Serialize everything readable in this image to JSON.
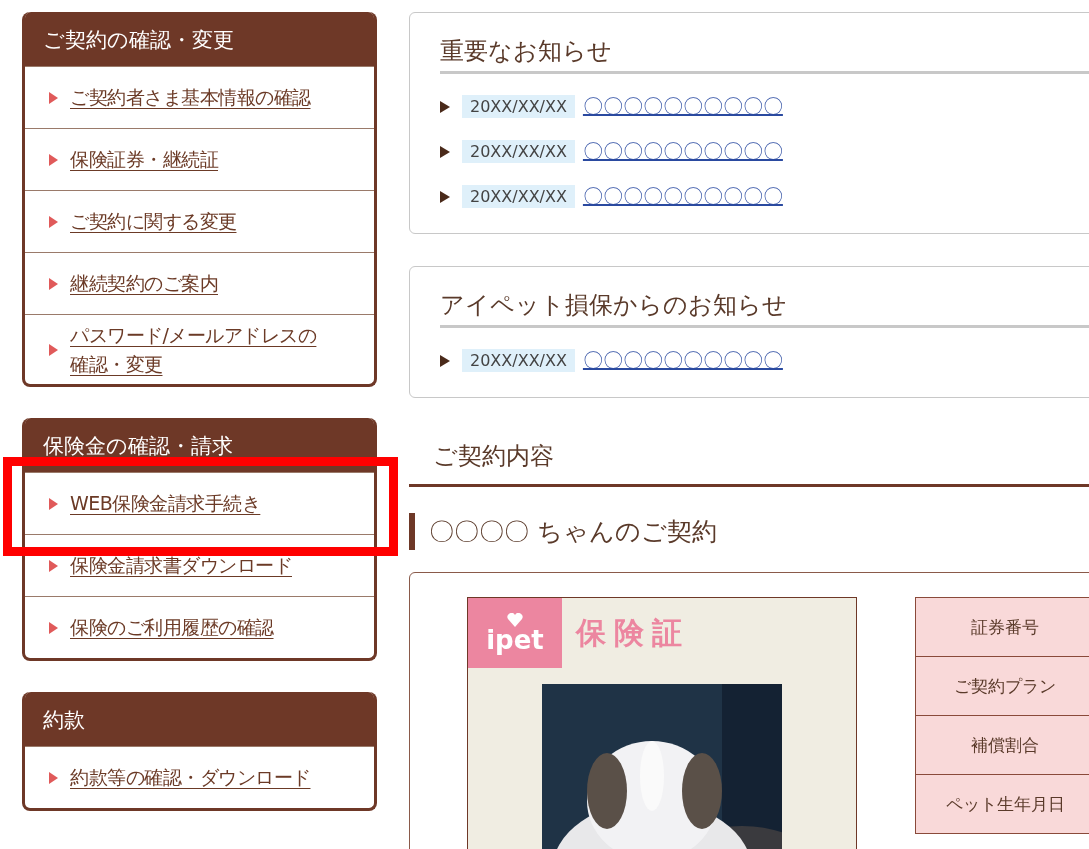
{
  "sidebar": [
    {
      "heading": "ご契約の確認・変更",
      "items": [
        {
          "label": "ご契約者さま基本情報の確認",
          "highlighted": false
        },
        {
          "label": "保険証券・継続証",
          "highlighted": false
        },
        {
          "label": "ご契約に関する変更",
          "highlighted": false
        },
        {
          "label": "継続契約のご案内",
          "highlighted": false
        },
        {
          "label": "パスワード/メールアドレスの確認・変更",
          "highlighted": false
        }
      ]
    },
    {
      "heading": "保険金の確認・請求",
      "items": [
        {
          "label": "WEB保険金請求手続き",
          "highlighted": true
        },
        {
          "label": "保険金請求書ダウンロード",
          "highlighted": false
        },
        {
          "label": "保険のご利用履歴の確認",
          "highlighted": false
        }
      ]
    },
    {
      "heading": "約款",
      "items": [
        {
          "label": "約款等の確認・ダウンロード",
          "highlighted": false
        }
      ]
    }
  ],
  "notices": [
    {
      "title": "重要なお知らせ",
      "items": [
        {
          "date": "20XX/XX/XX",
          "link": "〇〇〇〇〇〇〇〇〇〇"
        },
        {
          "date": "20XX/XX/XX",
          "link": "〇〇〇〇〇〇〇〇〇〇"
        },
        {
          "date": "20XX/XX/XX",
          "link": "〇〇〇〇〇〇〇〇〇〇"
        }
      ]
    },
    {
      "title": "アイペット損保からのお知らせ",
      "items": [
        {
          "date": "20XX/XX/XX",
          "link": "〇〇〇〇〇〇〇〇〇〇"
        }
      ]
    }
  ],
  "contract_heading": "ご契約内容",
  "contract_title": "〇〇〇〇 ちゃんのご契約",
  "certificate": {
    "logo": "ipet",
    "title": "保険証"
  },
  "details_table": {
    "rows": [
      "証券番号",
      "ご契約プラン",
      "補償割合",
      "ペット生年月日"
    ]
  }
}
